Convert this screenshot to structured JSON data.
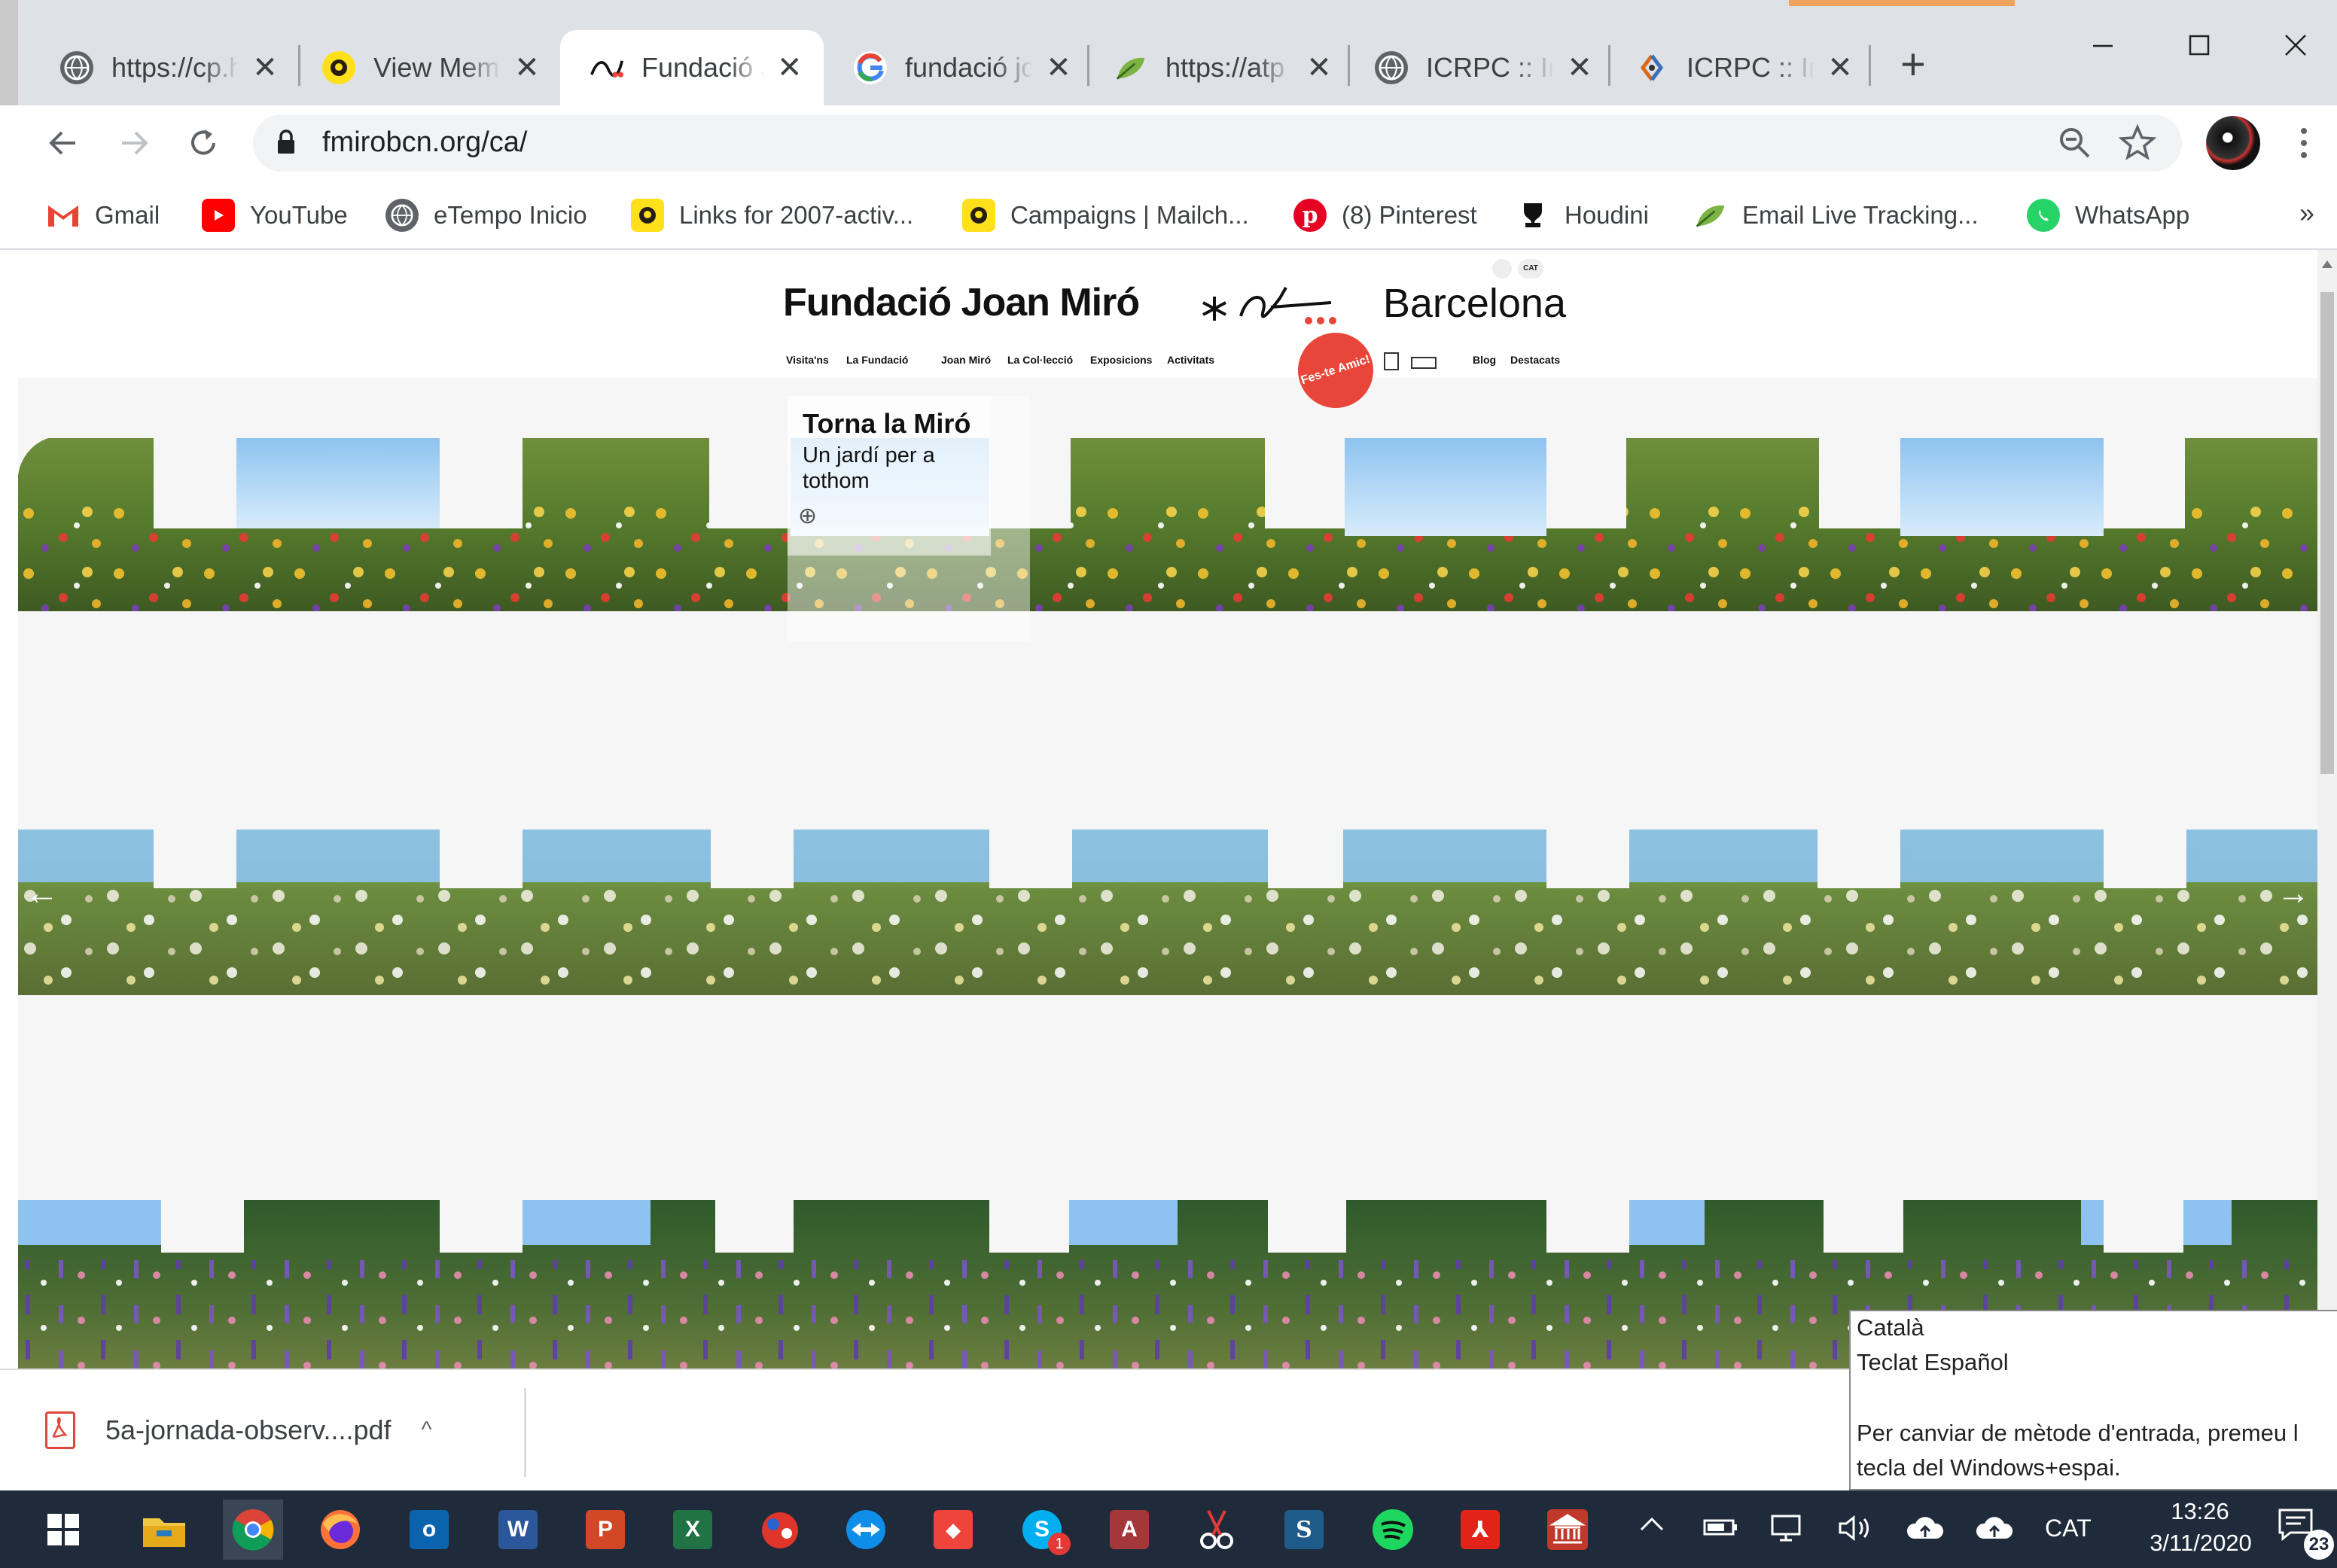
{
  "browser": {
    "tabs": [
      {
        "title": "https://cp.h",
        "favicon": "globe-icon"
      },
      {
        "title": "View Memb",
        "favicon": "mailchimp-icon"
      },
      {
        "title": "Fundació Jo",
        "favicon": "miro-icon",
        "active": true
      },
      {
        "title": "fundació jo",
        "favicon": "google-icon"
      },
      {
        "title": "https://atp",
        "favicon": "leaf-icon"
      },
      {
        "title": "ICRPC :: Ins",
        "favicon": "globe-icon"
      },
      {
        "title": "ICRPC :: Ins",
        "favicon": "icrpc-icon"
      }
    ],
    "new_tab": "+",
    "url": "fmirobcn.org/ca/",
    "bookmarks": [
      {
        "label": "Gmail",
        "icon": "gmail-icon"
      },
      {
        "label": "YouTube",
        "icon": "youtube-icon"
      },
      {
        "label": "eTempo Inicio",
        "icon": "globe-icon"
      },
      {
        "label": "Links for 2007-activ...",
        "icon": "mailchimp-icon"
      },
      {
        "label": "Campaigns | Mailch...",
        "icon": "mailchimp-icon"
      },
      {
        "label": "(8) Pinterest",
        "icon": "pinterest-icon"
      },
      {
        "label": "Houdini",
        "icon": "houdini-icon"
      },
      {
        "label": "Email Live Tracking...",
        "icon": "leaf-icon"
      },
      {
        "label": "WhatsApp",
        "icon": "whatsapp-icon"
      }
    ],
    "bookmarks_more": "»"
  },
  "site": {
    "logo_left": "Fundació Joan Miró",
    "logo_right": "Barcelona",
    "lang": "CAT",
    "nav": [
      "Visita'ns",
      "La Fundació",
      "Joan Miró",
      "La Col·lecció",
      "Exposicions",
      "Activitats",
      "Blog",
      "Destacats"
    ],
    "friend_badge": "Fes-te Amic!",
    "hero": {
      "title": "Torna la Miró",
      "subtitle": "Un jardí per a tothom",
      "plus": "⊕"
    },
    "arrows": {
      "prev": "←",
      "next": "→"
    }
  },
  "ime": {
    "line1": "Català",
    "line2": "Teclat Español",
    "line3": "Per canviar de mètode d'entrada, premeu l",
    "line4": "tecla del Windows+espai."
  },
  "download": {
    "filename": "5a-jornada-observ....pdf",
    "chevron": "^"
  },
  "taskbar": {
    "lang": "CAT",
    "time": "13:26",
    "date": "3/11/2020",
    "notification_count": "23",
    "skype_badge": "1"
  },
  "colors": {
    "accent_red": "#e8463a",
    "taskbar": "#1f2b3a",
    "sky": "#8ec3f0"
  }
}
